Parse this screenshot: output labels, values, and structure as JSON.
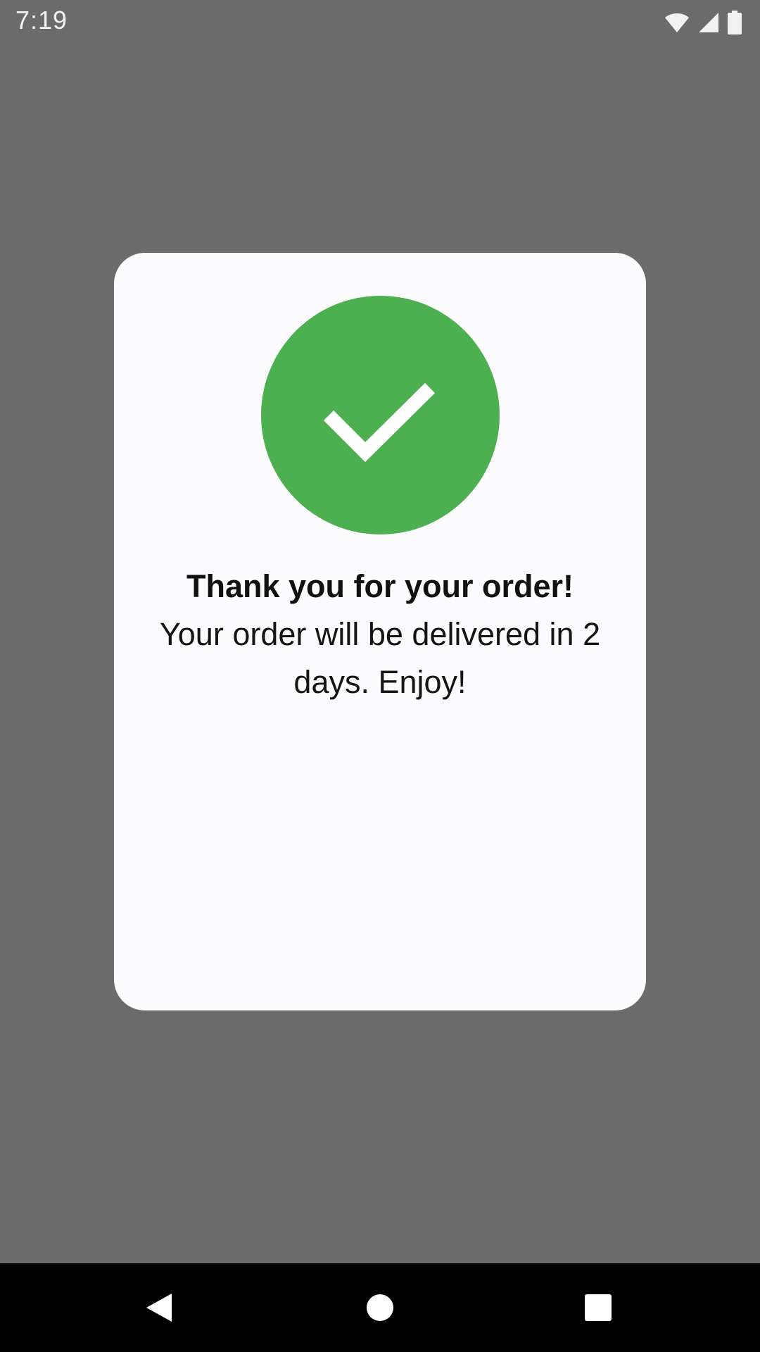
{
  "status_bar": {
    "time": "7:19",
    "icons": [
      "wifi-icon",
      "cell-signal-icon",
      "battery-icon"
    ]
  },
  "dialog": {
    "icon": "checkmark-icon",
    "icon_color": "#4caf50",
    "title": "Thank you for your order!",
    "message": "Your order will be delivered in 2 days. Enjoy!"
  },
  "nav_bar": {
    "buttons": [
      "back-icon",
      "home-icon",
      "recents-icon"
    ]
  },
  "colors": {
    "scrim": "#6b6b6b",
    "dialog_background": "#fcfcfe",
    "success": "#4caf50",
    "nav_bar": "#000000"
  }
}
